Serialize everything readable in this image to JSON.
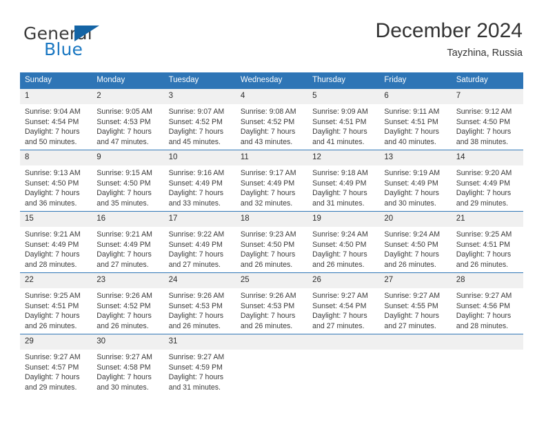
{
  "brand": {
    "name_top": "General",
    "name_bottom": "Blue",
    "accent_color": "#1b78c2",
    "triangle_color": "#1464a5"
  },
  "header": {
    "month_title": "December 2024",
    "location": "Tayzhina, Russia"
  },
  "calendar": {
    "header_bg": "#2e75b6",
    "day_band_bg": "#f0f0f0",
    "weekdays": [
      "Sunday",
      "Monday",
      "Tuesday",
      "Wednesday",
      "Thursday",
      "Friday",
      "Saturday"
    ],
    "weeks": [
      [
        {
          "day": "1",
          "sunrise": "Sunrise: 9:04 AM",
          "sunset": "Sunset: 4:54 PM",
          "daylight_line1": "Daylight: 7 hours",
          "daylight_line2": "and 50 minutes."
        },
        {
          "day": "2",
          "sunrise": "Sunrise: 9:05 AM",
          "sunset": "Sunset: 4:53 PM",
          "daylight_line1": "Daylight: 7 hours",
          "daylight_line2": "and 47 minutes."
        },
        {
          "day": "3",
          "sunrise": "Sunrise: 9:07 AM",
          "sunset": "Sunset: 4:52 PM",
          "daylight_line1": "Daylight: 7 hours",
          "daylight_line2": "and 45 minutes."
        },
        {
          "day": "4",
          "sunrise": "Sunrise: 9:08 AM",
          "sunset": "Sunset: 4:52 PM",
          "daylight_line1": "Daylight: 7 hours",
          "daylight_line2": "and 43 minutes."
        },
        {
          "day": "5",
          "sunrise": "Sunrise: 9:09 AM",
          "sunset": "Sunset: 4:51 PM",
          "daylight_line1": "Daylight: 7 hours",
          "daylight_line2": "and 41 minutes."
        },
        {
          "day": "6",
          "sunrise": "Sunrise: 9:11 AM",
          "sunset": "Sunset: 4:51 PM",
          "daylight_line1": "Daylight: 7 hours",
          "daylight_line2": "and 40 minutes."
        },
        {
          "day": "7",
          "sunrise": "Sunrise: 9:12 AM",
          "sunset": "Sunset: 4:50 PM",
          "daylight_line1": "Daylight: 7 hours",
          "daylight_line2": "and 38 minutes."
        }
      ],
      [
        {
          "day": "8",
          "sunrise": "Sunrise: 9:13 AM",
          "sunset": "Sunset: 4:50 PM",
          "daylight_line1": "Daylight: 7 hours",
          "daylight_line2": "and 36 minutes."
        },
        {
          "day": "9",
          "sunrise": "Sunrise: 9:15 AM",
          "sunset": "Sunset: 4:50 PM",
          "daylight_line1": "Daylight: 7 hours",
          "daylight_line2": "and 35 minutes."
        },
        {
          "day": "10",
          "sunrise": "Sunrise: 9:16 AM",
          "sunset": "Sunset: 4:49 PM",
          "daylight_line1": "Daylight: 7 hours",
          "daylight_line2": "and 33 minutes."
        },
        {
          "day": "11",
          "sunrise": "Sunrise: 9:17 AM",
          "sunset": "Sunset: 4:49 PM",
          "daylight_line1": "Daylight: 7 hours",
          "daylight_line2": "and 32 minutes."
        },
        {
          "day": "12",
          "sunrise": "Sunrise: 9:18 AM",
          "sunset": "Sunset: 4:49 PM",
          "daylight_line1": "Daylight: 7 hours",
          "daylight_line2": "and 31 minutes."
        },
        {
          "day": "13",
          "sunrise": "Sunrise: 9:19 AM",
          "sunset": "Sunset: 4:49 PM",
          "daylight_line1": "Daylight: 7 hours",
          "daylight_line2": "and 30 minutes."
        },
        {
          "day": "14",
          "sunrise": "Sunrise: 9:20 AM",
          "sunset": "Sunset: 4:49 PM",
          "daylight_line1": "Daylight: 7 hours",
          "daylight_line2": "and 29 minutes."
        }
      ],
      [
        {
          "day": "15",
          "sunrise": "Sunrise: 9:21 AM",
          "sunset": "Sunset: 4:49 PM",
          "daylight_line1": "Daylight: 7 hours",
          "daylight_line2": "and 28 minutes."
        },
        {
          "day": "16",
          "sunrise": "Sunrise: 9:21 AM",
          "sunset": "Sunset: 4:49 PM",
          "daylight_line1": "Daylight: 7 hours",
          "daylight_line2": "and 27 minutes."
        },
        {
          "day": "17",
          "sunrise": "Sunrise: 9:22 AM",
          "sunset": "Sunset: 4:49 PM",
          "daylight_line1": "Daylight: 7 hours",
          "daylight_line2": "and 27 minutes."
        },
        {
          "day": "18",
          "sunrise": "Sunrise: 9:23 AM",
          "sunset": "Sunset: 4:50 PM",
          "daylight_line1": "Daylight: 7 hours",
          "daylight_line2": "and 26 minutes."
        },
        {
          "day": "19",
          "sunrise": "Sunrise: 9:24 AM",
          "sunset": "Sunset: 4:50 PM",
          "daylight_line1": "Daylight: 7 hours",
          "daylight_line2": "and 26 minutes."
        },
        {
          "day": "20",
          "sunrise": "Sunrise: 9:24 AM",
          "sunset": "Sunset: 4:50 PM",
          "daylight_line1": "Daylight: 7 hours",
          "daylight_line2": "and 26 minutes."
        },
        {
          "day": "21",
          "sunrise": "Sunrise: 9:25 AM",
          "sunset": "Sunset: 4:51 PM",
          "daylight_line1": "Daylight: 7 hours",
          "daylight_line2": "and 26 minutes."
        }
      ],
      [
        {
          "day": "22",
          "sunrise": "Sunrise: 9:25 AM",
          "sunset": "Sunset: 4:51 PM",
          "daylight_line1": "Daylight: 7 hours",
          "daylight_line2": "and 26 minutes."
        },
        {
          "day": "23",
          "sunrise": "Sunrise: 9:26 AM",
          "sunset": "Sunset: 4:52 PM",
          "daylight_line1": "Daylight: 7 hours",
          "daylight_line2": "and 26 minutes."
        },
        {
          "day": "24",
          "sunrise": "Sunrise: 9:26 AM",
          "sunset": "Sunset: 4:53 PM",
          "daylight_line1": "Daylight: 7 hours",
          "daylight_line2": "and 26 minutes."
        },
        {
          "day": "25",
          "sunrise": "Sunrise: 9:26 AM",
          "sunset": "Sunset: 4:53 PM",
          "daylight_line1": "Daylight: 7 hours",
          "daylight_line2": "and 26 minutes."
        },
        {
          "day": "26",
          "sunrise": "Sunrise: 9:27 AM",
          "sunset": "Sunset: 4:54 PM",
          "daylight_line1": "Daylight: 7 hours",
          "daylight_line2": "and 27 minutes."
        },
        {
          "day": "27",
          "sunrise": "Sunrise: 9:27 AM",
          "sunset": "Sunset: 4:55 PM",
          "daylight_line1": "Daylight: 7 hours",
          "daylight_line2": "and 27 minutes."
        },
        {
          "day": "28",
          "sunrise": "Sunrise: 9:27 AM",
          "sunset": "Sunset: 4:56 PM",
          "daylight_line1": "Daylight: 7 hours",
          "daylight_line2": "and 28 minutes."
        }
      ],
      [
        {
          "day": "29",
          "sunrise": "Sunrise: 9:27 AM",
          "sunset": "Sunset: 4:57 PM",
          "daylight_line1": "Daylight: 7 hours",
          "daylight_line2": "and 29 minutes."
        },
        {
          "day": "30",
          "sunrise": "Sunrise: 9:27 AM",
          "sunset": "Sunset: 4:58 PM",
          "daylight_line1": "Daylight: 7 hours",
          "daylight_line2": "and 30 minutes."
        },
        {
          "day": "31",
          "sunrise": "Sunrise: 9:27 AM",
          "sunset": "Sunset: 4:59 PM",
          "daylight_line1": "Daylight: 7 hours",
          "daylight_line2": "and 31 minutes."
        },
        {
          "day": "",
          "sunrise": "",
          "sunset": "",
          "daylight_line1": "",
          "daylight_line2": ""
        },
        {
          "day": "",
          "sunrise": "",
          "sunset": "",
          "daylight_line1": "",
          "daylight_line2": ""
        },
        {
          "day": "",
          "sunrise": "",
          "sunset": "",
          "daylight_line1": "",
          "daylight_line2": ""
        },
        {
          "day": "",
          "sunrise": "",
          "sunset": "",
          "daylight_line1": "",
          "daylight_line2": ""
        }
      ]
    ]
  }
}
